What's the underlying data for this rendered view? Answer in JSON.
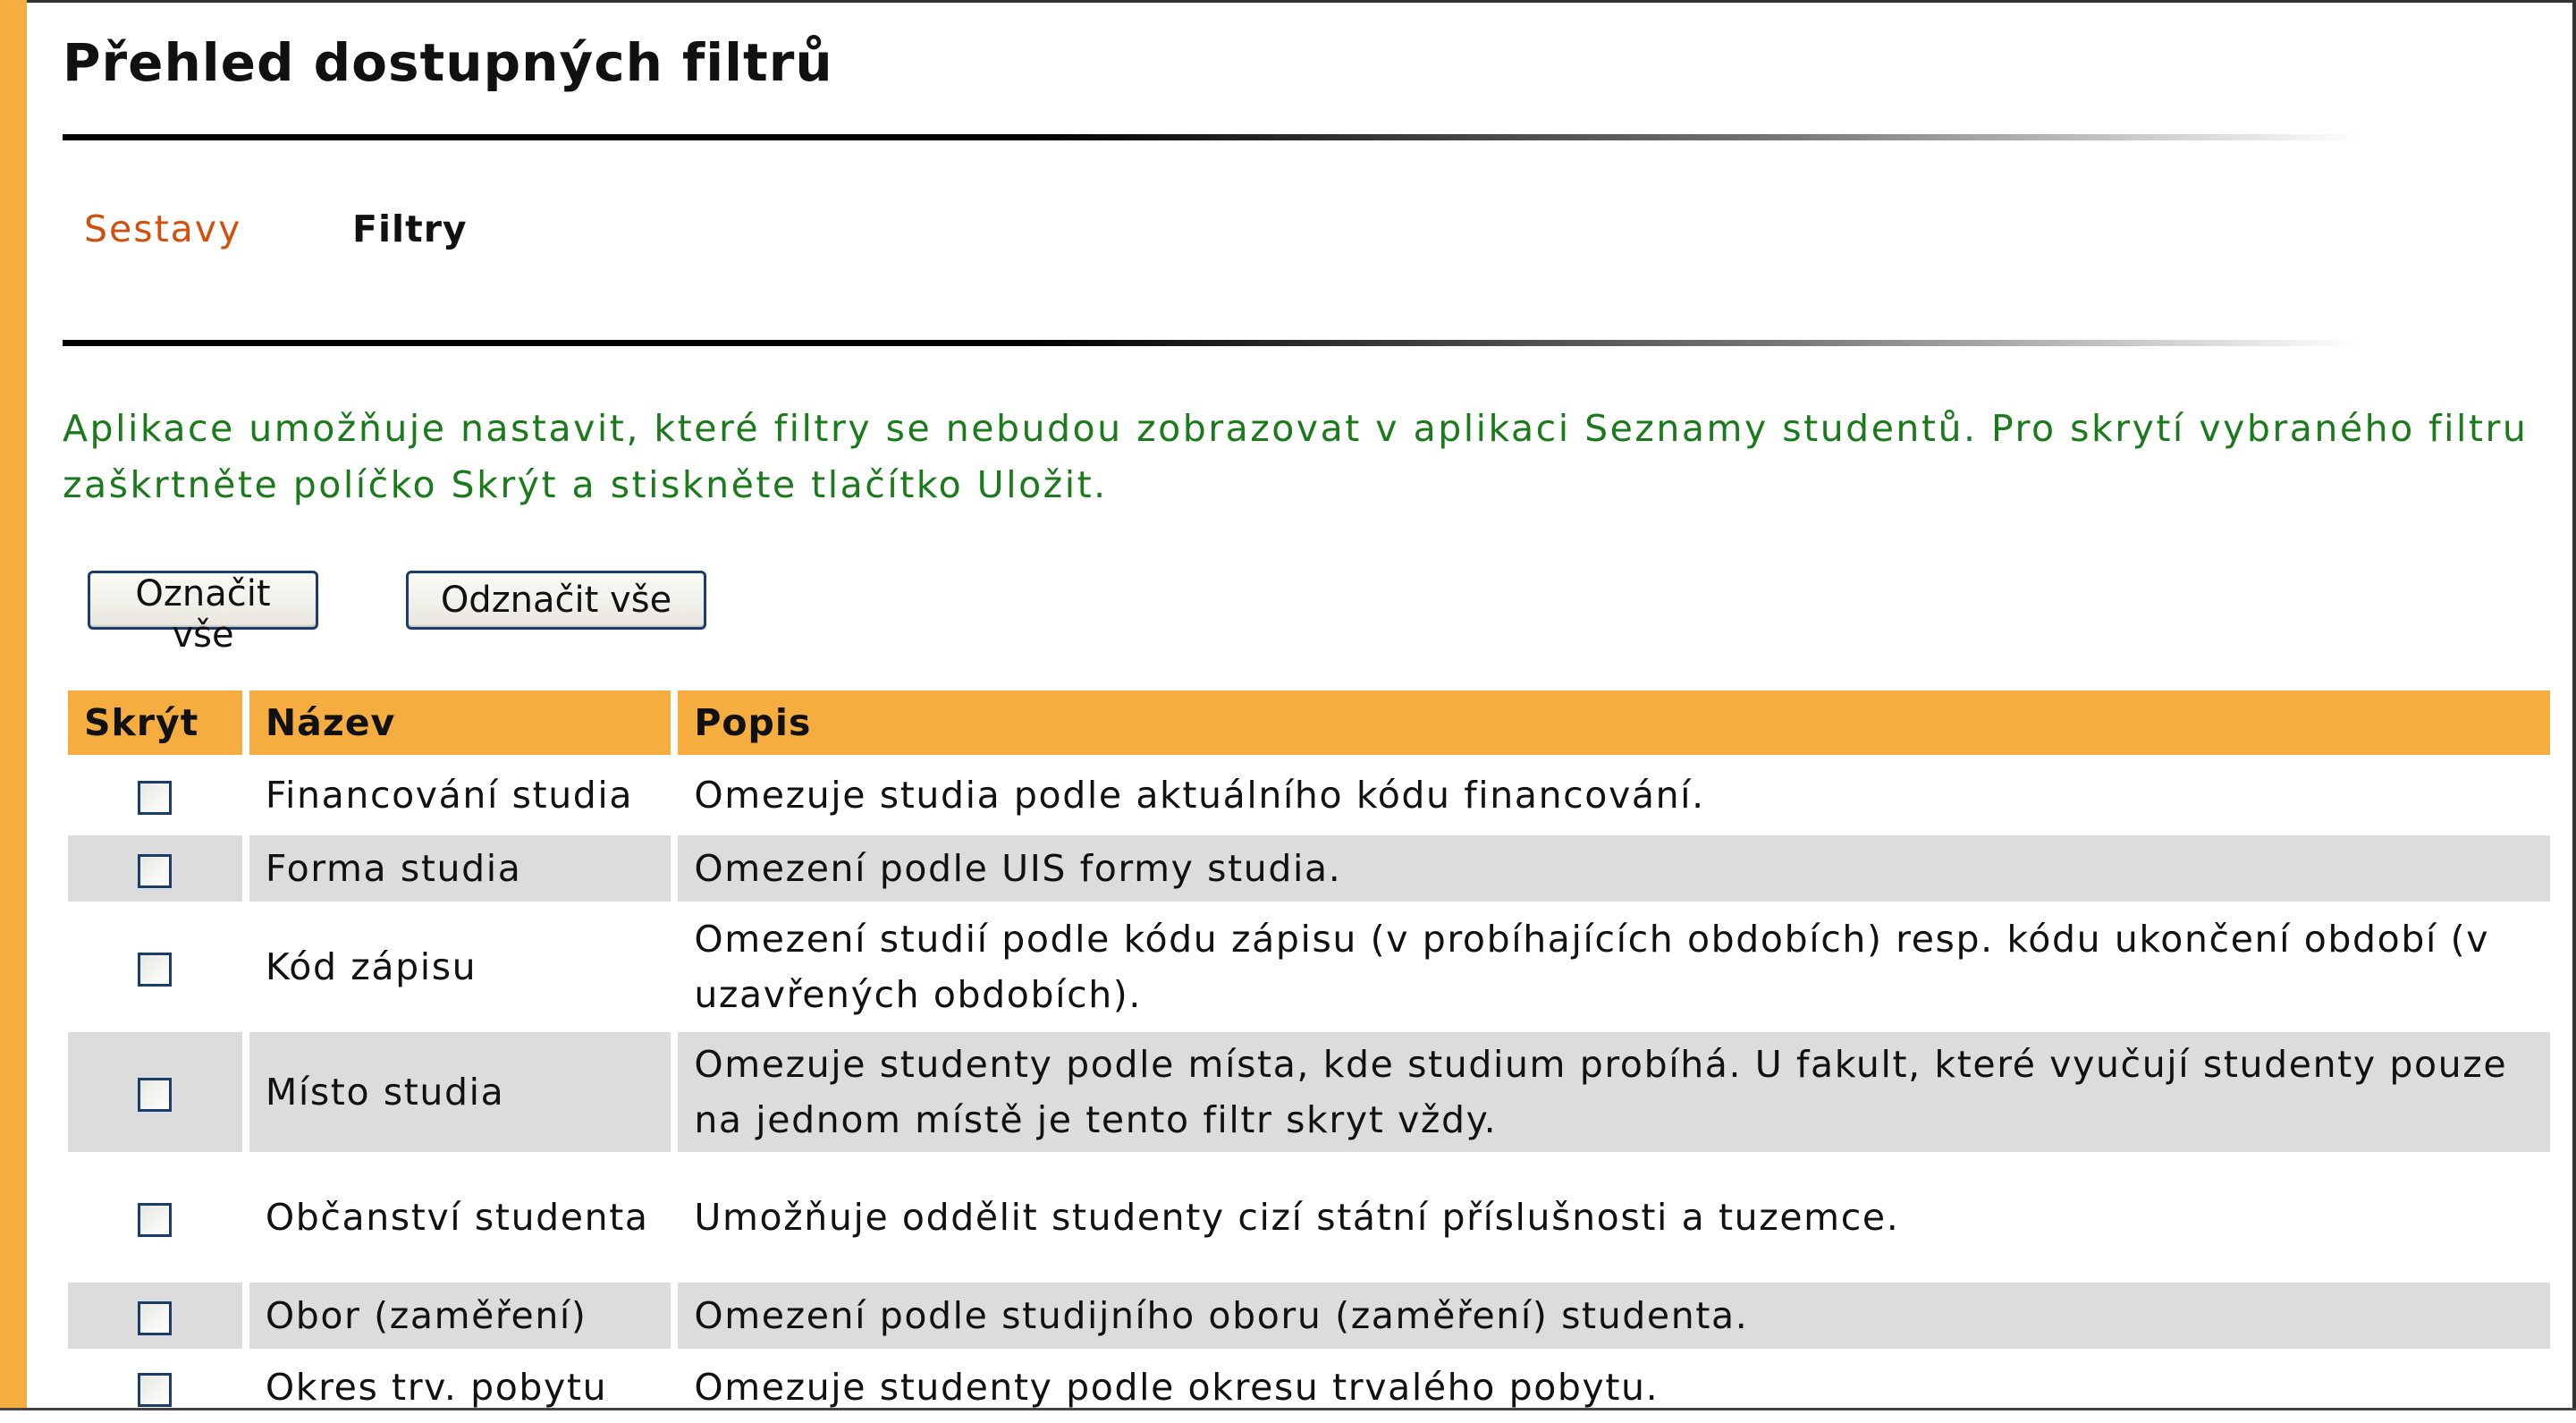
{
  "page": {
    "title": "Přehled dostupných filtrů"
  },
  "tabs": {
    "link": "Sestavy",
    "current": "Filtry"
  },
  "info": {
    "line1": "Aplikace umožňuje nastavit, které filtry se nebudou zobrazovat v aplikaci Seznamy studentů. Pro skrytí vybraného filtru",
    "line2": "zaškrtněte políčko Skrýt a stiskněte tlačítko Uložit."
  },
  "buttons": {
    "select_all": "Označit vše",
    "deselect_all": "Odznačit vše"
  },
  "table": {
    "headers": [
      "Skrýt",
      "Název",
      "Popis"
    ],
    "rows": [
      {
        "checked": false,
        "name": "Financování studia",
        "desc": "Omezuje studia podle aktuálního kódu financování."
      },
      {
        "checked": false,
        "name": "Forma studia",
        "desc": "Omezení podle UIS formy studia."
      },
      {
        "checked": false,
        "name": "Kód zápisu",
        "desc": "Omezení studií podle kódu zápisu (v probíhajících obdobích) resp. kódu ukončení období (v uzavřených obdobích)."
      },
      {
        "checked": false,
        "name": "Místo studia",
        "desc": "Omezuje studenty podle místa, kde studium probíhá. U fakult, které vyučují studenty pouze na jednom místě je tento filtr skryt vždy."
      },
      {
        "checked": false,
        "name": "Občanství studenta",
        "desc": "Umožňuje oddělit studenty cizí státní příslušnosti a tuzemce."
      },
      {
        "checked": false,
        "name": "Obor (zaměření)",
        "desc": "Omezení podle studijního oboru (zaměření) studenta."
      },
      {
        "checked": false,
        "name": "Okres trv. pobytu",
        "desc": "Omezuje studenty podle okresu trvalého pobytu."
      }
    ]
  },
  "colors": {
    "accent": "#f5ad3f",
    "link": "#d2500e",
    "info_text": "#1b7a1b",
    "row_alt": "#dcdcdc"
  }
}
